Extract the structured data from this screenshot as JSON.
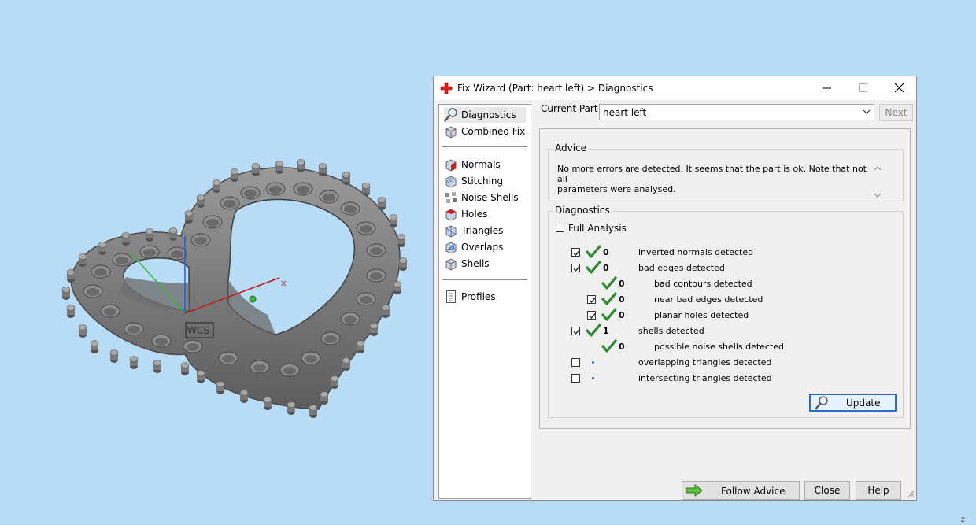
{
  "viewport": {
    "axis_x_label": "x",
    "wcs_label": "WCS",
    "corner_mark": "z"
  },
  "dialog": {
    "title": "Fix Wizard (Part: heart left) > Diagnostics",
    "current_part_label": "Current Part:",
    "current_part_value": "heart left",
    "next_label": "Next",
    "nav": {
      "top": [
        {
          "label": "Diagnostics",
          "icon": "magnifier-icon",
          "selected": true
        },
        {
          "label": "Combined Fix",
          "icon": "combined-fix-icon"
        }
      ],
      "middle": [
        {
          "label": "Normals",
          "icon": "normals-icon"
        },
        {
          "label": "Stitching",
          "icon": "stitching-icon"
        },
        {
          "label": "Noise Shells",
          "icon": "noise-shells-icon"
        },
        {
          "label": "Holes",
          "icon": "holes-icon"
        },
        {
          "label": "Triangles",
          "icon": "triangles-icon"
        },
        {
          "label": "Overlaps",
          "icon": "overlaps-icon"
        },
        {
          "label": "Shells",
          "icon": "shells-icon"
        }
      ],
      "bottom": [
        {
          "label": "Profiles",
          "icon": "document-icon"
        }
      ]
    },
    "advice": {
      "title": "Advice",
      "line1": "No more errors are detected. It seems that the part is ok. Note that not all",
      "line2": "parameters were analysed."
    },
    "diagnostics": {
      "title": "Diagnostics",
      "full_analysis_label": "Full Analysis",
      "full_analysis_checked": false,
      "rows": [
        {
          "checkbox": true,
          "checked": true,
          "status": "ok",
          "count": "0",
          "label": "inverted normals detected",
          "indent": 0
        },
        {
          "checkbox": true,
          "checked": true,
          "status": "ok",
          "count": "0",
          "label": "bad edges detected",
          "indent": 0
        },
        {
          "checkbox": false,
          "checked": false,
          "status": "ok",
          "count": "0",
          "label": "bad contours detected",
          "indent": 1
        },
        {
          "checkbox": true,
          "checked": true,
          "status": "ok",
          "count": "0",
          "label": "near bad edges detected",
          "indent": 1
        },
        {
          "checkbox": true,
          "checked": true,
          "status": "ok",
          "count": "0",
          "label": "planar holes detected",
          "indent": 1
        },
        {
          "checkbox": true,
          "checked": true,
          "status": "ok",
          "count": "1",
          "label": "shells detected",
          "indent": 0
        },
        {
          "checkbox": false,
          "checked": false,
          "status": "ok",
          "count": "0",
          "label": "possible noise shells detected",
          "indent": 1
        },
        {
          "checkbox": true,
          "checked": false,
          "status": "pending",
          "count": "",
          "label": "overlapping triangles detected",
          "indent": 0
        },
        {
          "checkbox": true,
          "checked": false,
          "status": "pending",
          "count": "",
          "label": "intersecting triangles detected",
          "indent": 0
        }
      ],
      "update_label": "Update"
    },
    "buttons": {
      "follow_advice": "Follow Advice",
      "close": "Close",
      "help": "Help"
    }
  },
  "colors": {
    "background": "#b9dcf6",
    "check_green": "#2e8b32",
    "update_border": "#2a6fc4",
    "model_gray": "#7c7c7c"
  }
}
